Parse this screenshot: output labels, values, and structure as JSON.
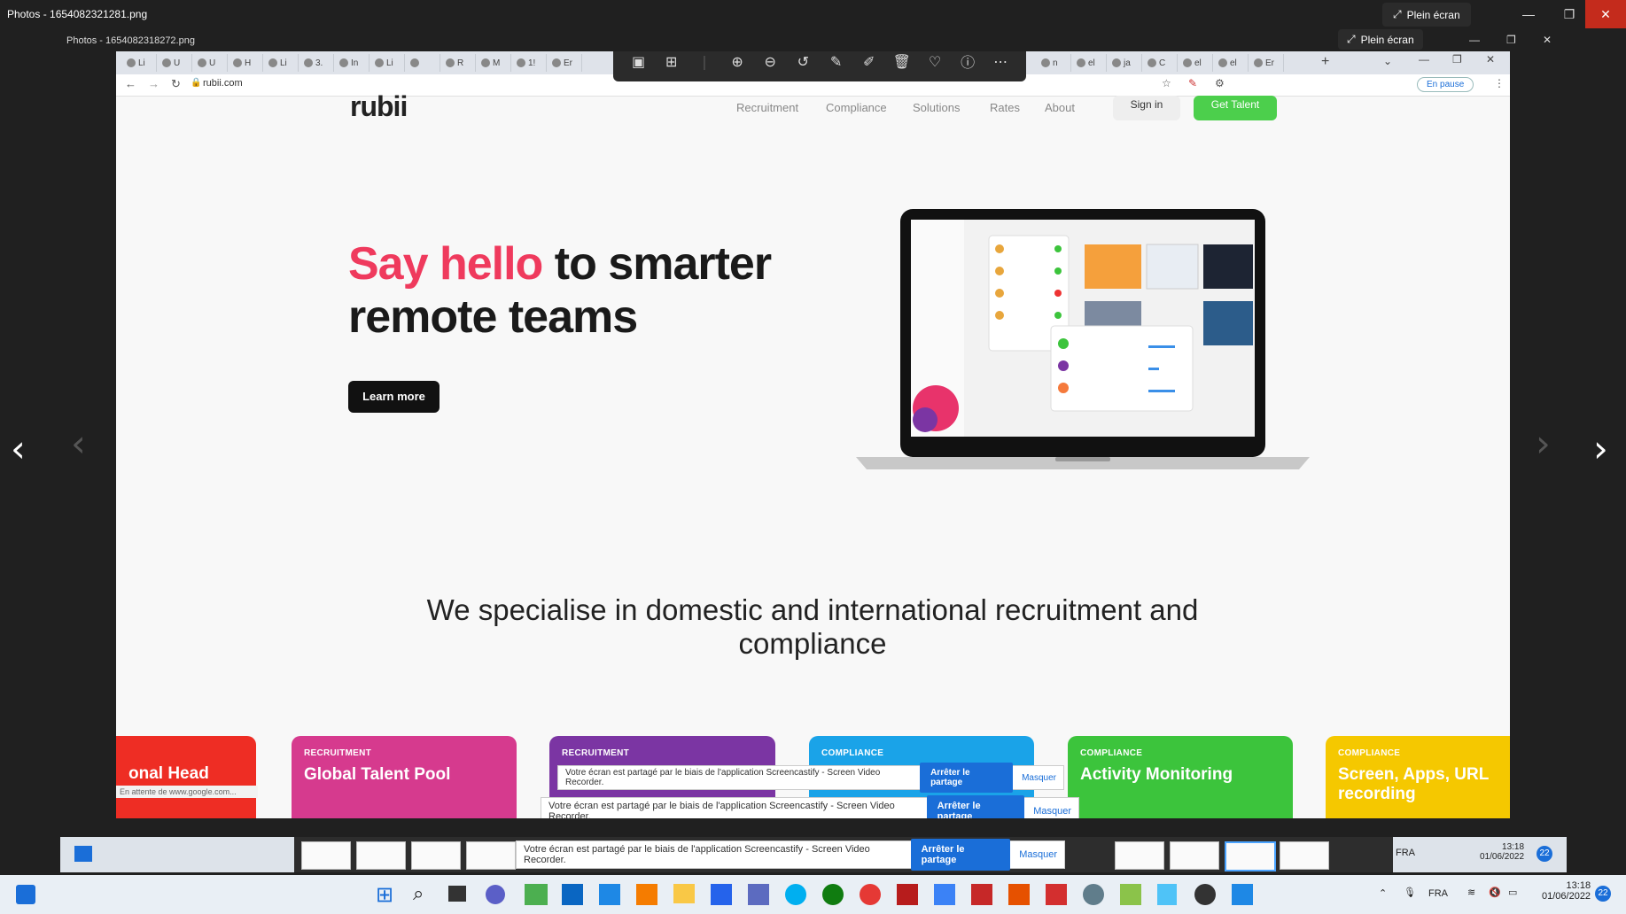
{
  "outer_window": {
    "title": "Photos - 1654082321281.png",
    "fullscreen_label": "Plein écran"
  },
  "inner_window": {
    "title": "Photos - 1654082318272.png",
    "fullscreen_label": "Plein écran"
  },
  "browser": {
    "url": "rubii.com",
    "pause_label": "En pause",
    "tabs": [
      "Li",
      "U",
      "U",
      "H",
      "Li",
      "3.",
      "In",
      "Li",
      "",
      "R",
      "M",
      "1!",
      "Er",
      "n",
      "el",
      "ja",
      "C",
      "el",
      "el",
      "Er"
    ]
  },
  "site": {
    "logo": "rubii",
    "nav": [
      "Recruitment",
      "Compliance",
      "Solutions",
      "Rates",
      "About"
    ],
    "signin_label": "Sign in",
    "get_talent_label": "Get Talent",
    "hero_highlight": "Say hello",
    "hero_rest": " to smarter remote teams",
    "learn_more": "Learn more",
    "subtitle": "We specialise in domestic and international recruitment and compliance",
    "cards": [
      {
        "category": "",
        "name": "onal Head",
        "color": "#ee2d24"
      },
      {
        "category": "RECRUITMENT",
        "name": "Global Talent Pool",
        "color": "#d63a8e"
      },
      {
        "category": "RECRUITMENT",
        "name": "",
        "color": "#7b35a3"
      },
      {
        "category": "COMPLIANCE",
        "name": "",
        "color": "#1aa3e8"
      },
      {
        "category": "COMPLIANCE",
        "name": "Activity Monitoring",
        "color": "#3cc43c"
      },
      {
        "category": "COMPLIANCE",
        "name": "Screen, Apps, URL recording",
        "color": "#f5c800"
      }
    ],
    "status_text": "En attente de www.google.com..."
  },
  "share_bar": {
    "message": "Votre écran est partagé par le biais de l'application Screencastify - Screen Video Recorder.",
    "stop_label": "Arrêter le partage",
    "hide_label": "Masquer"
  },
  "tray": {
    "lang": "FRA",
    "time": "13:18",
    "date": "01/06/2022",
    "badge": "22"
  }
}
